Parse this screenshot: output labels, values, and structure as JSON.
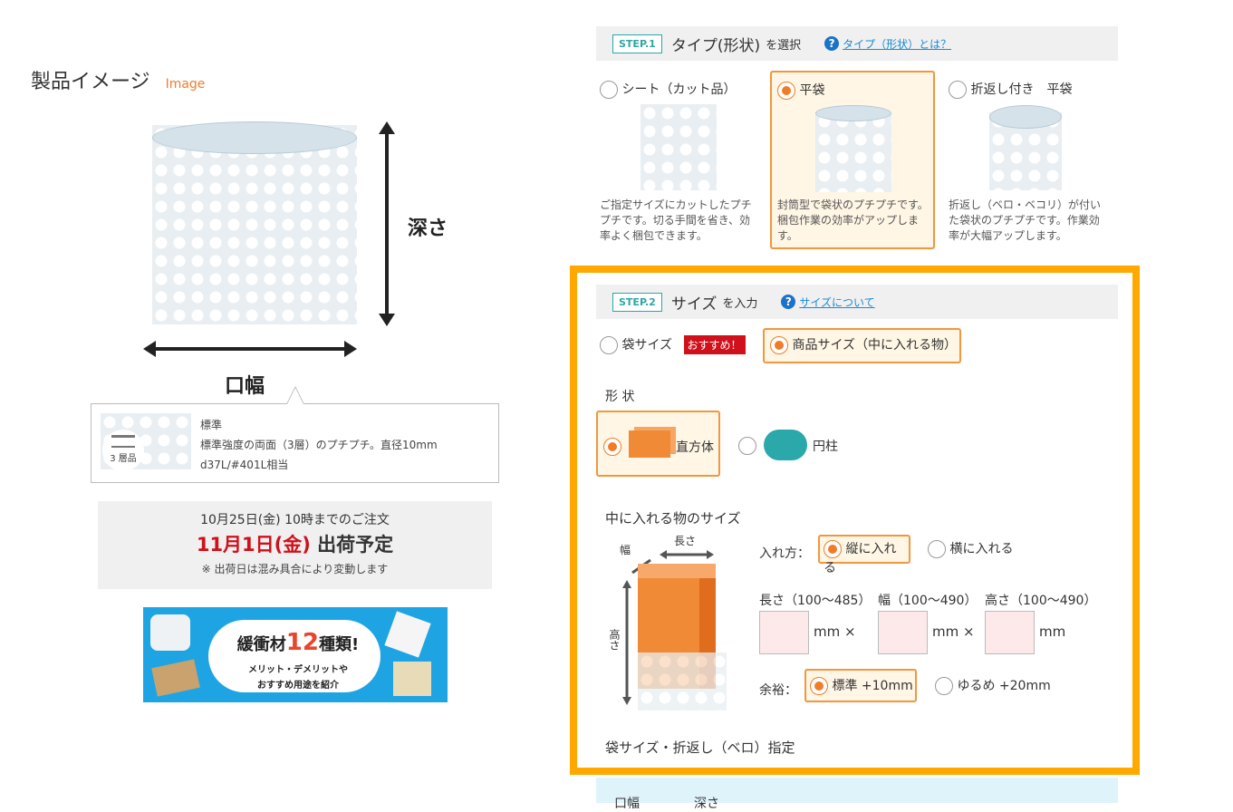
{
  "left": {
    "title": "製品イメージ",
    "title_en": "Image",
    "depth_label": "深さ",
    "width_label": "口幅",
    "info": {
      "badge_label": "3 層品",
      "name": "標準",
      "desc": "標準強度の両面（3層）のプチプチ。直径10mm",
      "code": "d37L/#401L相当"
    },
    "shipping": {
      "line1": "10月25日(金) 10時までのご注文",
      "date": "11月1日(金)",
      "plan": "出荷予定",
      "note": "※ 出荷日は混み具合により変動します"
    },
    "banner": {
      "main_a": "緩衝材",
      "main_num": "12",
      "main_b": "種類!",
      "sub1": "メリット・デメリットや",
      "sub2": "おすすめ用途を紹介"
    }
  },
  "step1": {
    "badge": "STEP.1",
    "title": "タイプ(形状)",
    "sub": "を選択",
    "help_icon": "?",
    "help_link": "タイプ（形状）とは？",
    "options": [
      {
        "label": "シート（カット品）",
        "desc": "ご指定サイズにカットしたプチプチです。切る手間を省き、効率よく梱包できます。",
        "selected": false
      },
      {
        "label": "平袋",
        "desc": "封筒型で袋状のプチプチです。梱包作業の効率がアップします。",
        "selected": true
      },
      {
        "label": "折返し付き　平袋",
        "desc": "折返し（ベロ・ベコリ）が付いた袋状のプチプチです。作業効率が大幅アップします。",
        "selected": false
      }
    ]
  },
  "step2": {
    "badge": "STEP.2",
    "title": "サイズ",
    "sub": "を入力",
    "help_icon": "?",
    "help_link": "サイズについて",
    "size_mode": {
      "bag_label": "袋サイズ",
      "recommend": "おすすめ！",
      "product_label": "商品サイズ（中に入れる物）"
    },
    "shape_heading": "形 状",
    "shapes": {
      "box": "直方体",
      "cylinder": "円柱"
    },
    "item_size_heading": "中に入れる物のサイズ",
    "diagram": {
      "length": "長さ",
      "width": "幅",
      "height": "高さ"
    },
    "insert": {
      "label": "入れ方：",
      "vertical": "縦に入れる",
      "horizontal": "横に入れる"
    },
    "dims": {
      "length_label": "長さ（100〜485）",
      "width_label": "幅（100〜490）",
      "height_label": "高さ（100〜490）",
      "unit": "mm",
      "times": "×",
      "length_value": "",
      "width_value": "",
      "height_value": ""
    },
    "margin": {
      "label": "余裕：",
      "standard": "標準 +10mm",
      "loose": "ゆるめ +20mm"
    },
    "bag_fold_heading": "袋サイズ・折返し（ベロ）指定"
  },
  "bottom_strip": {
    "col1": "口幅",
    "col2": "深さ"
  },
  "colors": {
    "accent": "#f07c2a",
    "highlight_border": "#ffa800",
    "teal": "#2ea6a6",
    "link": "#1a8ad4",
    "shipping_red": "#d0101b"
  }
}
